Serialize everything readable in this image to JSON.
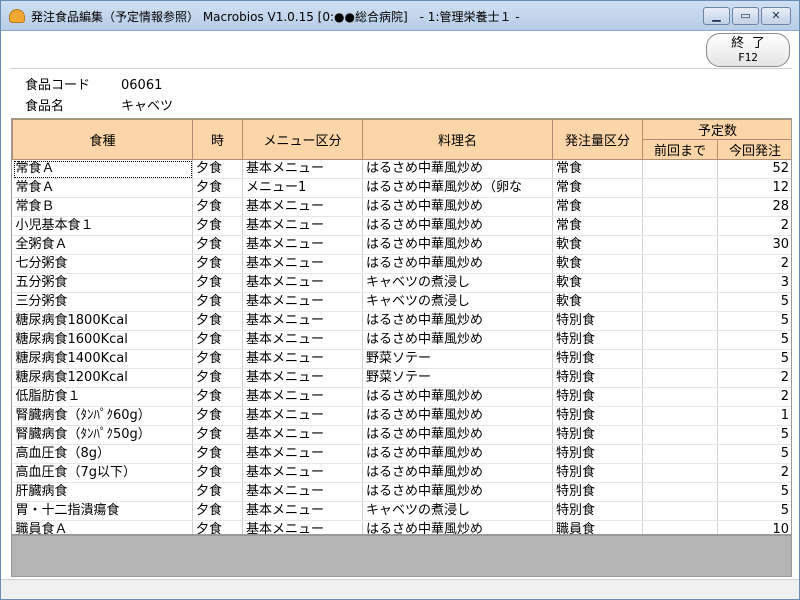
{
  "window": {
    "title": "発注食品編集（予定情報参照） Macrobios V1.0.15 [0:●●総合病院]　- 1:管理栄養士１ -",
    "min_glyph": "▁",
    "max_glyph": "▭",
    "close_glyph": "✕"
  },
  "toolbar": {
    "end_label": "終 了",
    "end_key": "F12"
  },
  "food": {
    "code_label": "食品コード",
    "code_value": "06061",
    "name_label": "食品名",
    "name_value": "キャベツ"
  },
  "table": {
    "headers": {
      "shokushu": "食種",
      "toki": "時",
      "menu": "メニュー区分",
      "ryouri": "料理名",
      "hacchu": "発注量区分",
      "yoteisu": "予定数",
      "zenkai": "前回まで",
      "konkai": "今回発注"
    },
    "rows": [
      {
        "shokushu": "常食Ａ",
        "toki": "夕食",
        "menu": "基本メニュー",
        "ryouri": "はるさめ中華風炒め",
        "hacchu": "常食",
        "zenkai": "",
        "konkai": "52"
      },
      {
        "shokushu": "常食Ａ",
        "toki": "夕食",
        "menu": "メニュー1",
        "ryouri": "はるさめ中華風炒め（卵な",
        "hacchu": "常食",
        "zenkai": "",
        "konkai": "12"
      },
      {
        "shokushu": "常食Ｂ",
        "toki": "夕食",
        "menu": "基本メニュー",
        "ryouri": "はるさめ中華風炒め",
        "hacchu": "常食",
        "zenkai": "",
        "konkai": "28"
      },
      {
        "shokushu": "小児基本食１",
        "toki": "夕食",
        "menu": "基本メニュー",
        "ryouri": "はるさめ中華風炒め",
        "hacchu": "常食",
        "zenkai": "",
        "konkai": "2"
      },
      {
        "shokushu": "全粥食Ａ",
        "toki": "夕食",
        "menu": "基本メニュー",
        "ryouri": "はるさめ中華風炒め",
        "hacchu": "軟食",
        "zenkai": "",
        "konkai": "30"
      },
      {
        "shokushu": "七分粥食",
        "toki": "夕食",
        "menu": "基本メニュー",
        "ryouri": "はるさめ中華風炒め",
        "hacchu": "軟食",
        "zenkai": "",
        "konkai": "2"
      },
      {
        "shokushu": "五分粥食",
        "toki": "夕食",
        "menu": "基本メニュー",
        "ryouri": "キャベツの煮浸し",
        "hacchu": "軟食",
        "zenkai": "",
        "konkai": "3"
      },
      {
        "shokushu": "三分粥食",
        "toki": "夕食",
        "menu": "基本メニュー",
        "ryouri": "キャベツの煮浸し",
        "hacchu": "軟食",
        "zenkai": "",
        "konkai": "5"
      },
      {
        "shokushu": "糖尿病食1800Kcal",
        "toki": "夕食",
        "menu": "基本メニュー",
        "ryouri": "はるさめ中華風炒め",
        "hacchu": "特別食",
        "zenkai": "",
        "konkai": "5"
      },
      {
        "shokushu": "糖尿病食1600Kcal",
        "toki": "夕食",
        "menu": "基本メニュー",
        "ryouri": "はるさめ中華風炒め",
        "hacchu": "特別食",
        "zenkai": "",
        "konkai": "5"
      },
      {
        "shokushu": "糖尿病食1400Kcal",
        "toki": "夕食",
        "menu": "基本メニュー",
        "ryouri": "野菜ソテー",
        "hacchu": "特別食",
        "zenkai": "",
        "konkai": "5"
      },
      {
        "shokushu": "糖尿病食1200Kcal",
        "toki": "夕食",
        "menu": "基本メニュー",
        "ryouri": "野菜ソテー",
        "hacchu": "特別食",
        "zenkai": "",
        "konkai": "2"
      },
      {
        "shokushu": "低脂肪食１",
        "toki": "夕食",
        "menu": "基本メニュー",
        "ryouri": "はるさめ中華風炒め",
        "hacchu": "特別食",
        "zenkai": "",
        "konkai": "2"
      },
      {
        "shokushu": "腎臓病食（ﾀﾝﾊﾟｸ60g）",
        "toki": "夕食",
        "menu": "基本メニュー",
        "ryouri": "はるさめ中華風炒め",
        "hacchu": "特別食",
        "zenkai": "",
        "konkai": "1"
      },
      {
        "shokushu": "腎臓病食（ﾀﾝﾊﾟｸ50g）",
        "toki": "夕食",
        "menu": "基本メニュー",
        "ryouri": "はるさめ中華風炒め",
        "hacchu": "特別食",
        "zenkai": "",
        "konkai": "5"
      },
      {
        "shokushu": "高血圧食（8g）",
        "toki": "夕食",
        "menu": "基本メニュー",
        "ryouri": "はるさめ中華風炒め",
        "hacchu": "特別食",
        "zenkai": "",
        "konkai": "5"
      },
      {
        "shokushu": "高血圧食（7g以下）",
        "toki": "夕食",
        "menu": "基本メニュー",
        "ryouri": "はるさめ中華風炒め",
        "hacchu": "特別食",
        "zenkai": "",
        "konkai": "2"
      },
      {
        "shokushu": "肝臓病食",
        "toki": "夕食",
        "menu": "基本メニュー",
        "ryouri": "はるさめ中華風炒め",
        "hacchu": "特別食",
        "zenkai": "",
        "konkai": "5"
      },
      {
        "shokushu": "胃・十二指潰瘍食",
        "toki": "夕食",
        "menu": "基本メニュー",
        "ryouri": "キャベツの煮浸し",
        "hacchu": "特別食",
        "zenkai": "",
        "konkai": "5"
      },
      {
        "shokushu": "職員食Ａ",
        "toki": "夕食",
        "menu": "基本メニュー",
        "ryouri": "はるさめ中華風炒め",
        "hacchu": "職員食",
        "zenkai": "",
        "konkai": "10"
      }
    ]
  }
}
